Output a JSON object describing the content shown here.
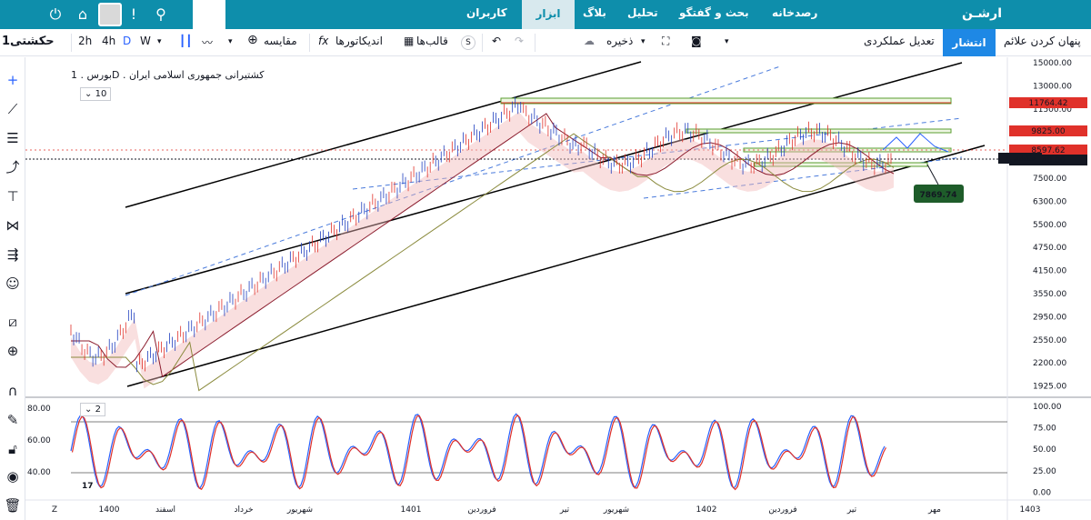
{
  "nav": {
    "logo_text": "ارشـن",
    "items": [
      "رصدخانه",
      "بحث و گفتگو",
      "تحلیل",
      "بلاگ",
      "ابزار",
      "کاربران"
    ],
    "active": "ابزار"
  },
  "toolbar": {
    "symbol": "حکشتی1",
    "intervals": [
      "2h",
      "4h",
      "D",
      "W"
    ],
    "active_interval": "D",
    "compare": "مقایسه",
    "indicators": "اندیکاتورها",
    "templates": "قالب‌ها",
    "save": "ذخیره",
    "fx_label": "fx",
    "s_label": "S",
    "performance": "تعدیل عملکردی",
    "publish": "انتشار",
    "hide_signs": "پنهان کردن علائم"
  },
  "chart": {
    "legend": "بورس . 1D . کشتیرانی جمهوری اسلامی ایران",
    "main_pane_count": "10",
    "osc_pane_count": "2",
    "price_ticks": [
      "15000.00",
      "13000.00",
      "11500.00",
      "10000.00",
      "9000.00",
      "7500.00",
      "6300.00",
      "5500.00",
      "4750.00",
      "4150.00",
      "3550.00",
      "2950.00",
      "2550.00",
      "2200.00",
      "1925.00"
    ],
    "price_labels": {
      "level1": "11764.42",
      "level2": "9825.00",
      "level3": "8597.62",
      "current": "8140.00",
      "symbol_tag": "حکشتی1",
      "target": "7869.74"
    },
    "osc_left_ticks": [
      "80.00",
      "60.00",
      "40.00"
    ],
    "osc_right_ticks": [
      "100.00",
      "75.00",
      "50.00",
      "25.00",
      "0.00"
    ],
    "time_ticks": [
      "1400",
      "اسفند",
      "خرداد",
      "شهریور",
      "1401",
      "فروردین",
      "تیر",
      "شهریور",
      "1402",
      "فروردین",
      "تیر",
      "مهر",
      "1403"
    ],
    "corner_z": "Z",
    "watermark": "17",
    "colors": {
      "candle_up": "#1f3fbf",
      "candle_down": "#e0312a",
      "accent": "#0e8eab"
    }
  },
  "sidebar": {
    "tools": [
      "crosshair-icon",
      "trendline-icon",
      "fib-icon",
      "pattern-icon",
      "brush-icon",
      "projection-icon",
      "measure-icon",
      "emoji-icon",
      "ruler-icon",
      "zoom-icon",
      "magnet-icon",
      "lock-drawing-icon",
      "lock-icon",
      "eye-icon",
      "trash-icon"
    ]
  }
}
